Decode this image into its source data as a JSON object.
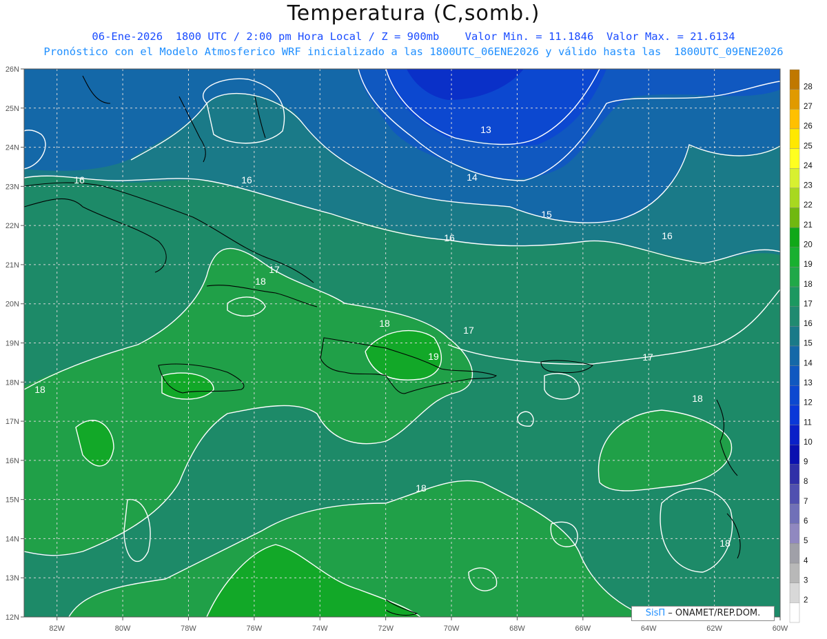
{
  "header": {
    "title": "Temperatura (C,somb.)",
    "line1": "06-Ene-2026  1800 UTC / 2:00 pm Hora Local / Z = 900mb    Valor Min. = 11.1846  Valor Max. = 21.6134",
    "line2": "Pronóstico con el Modelo Atmosferico WRF inicializado a las 1800UTC_06ENE2026 y válido hasta las  1800UTC_09ENE2026"
  },
  "credit": {
    "brand": "SisΠ",
    "text": " – ONAMET/REP.DOM."
  },
  "map_data": {
    "lon_range": [
      -83,
      -60
    ],
    "lat_range": [
      12,
      26
    ],
    "lon_ticks": [
      "82W",
      "80W",
      "78W",
      "76W",
      "74W",
      "72W",
      "70W",
      "68W",
      "66W",
      "64W",
      "62W",
      "60W"
    ],
    "lat_ticks": [
      "12N",
      "13N",
      "14N",
      "15N",
      "16N",
      "17N",
      "18N",
      "19N",
      "20N",
      "21N",
      "22N",
      "23N",
      "24N",
      "25N",
      "26N"
    ],
    "contour_labels": [
      "16",
      "16",
      "13",
      "14",
      "15",
      "16",
      "16",
      "17",
      "18",
      "18",
      "17",
      "19",
      "17",
      "18",
      "18",
      "18",
      "18"
    ],
    "colorbar": {
      "levels": [
        "28",
        "27",
        "26",
        "25",
        "24",
        "23",
        "22",
        "21",
        "20",
        "19",
        "18",
        "17",
        "16",
        "15",
        "14",
        "13",
        "12",
        "11",
        "10",
        "9",
        "8",
        "7",
        "6",
        "5",
        "4",
        "3",
        "2"
      ],
      "colors": [
        "#c07800",
        "#e09a00",
        "#ffc000",
        "#ffe800",
        "#ffff20",
        "#d8f030",
        "#a8d820",
        "#70b810",
        "#10a818",
        "#18b030",
        "#20a848",
        "#1c9860",
        "#208a70",
        "#1a7a88",
        "#1468a8",
        "#1058c0",
        "#0c48d0",
        "#0a38d8",
        "#0a20c8",
        "#0a10b0",
        "#3030a8",
        "#5050b0",
        "#7070b8",
        "#9088c0",
        "#a0a0a8",
        "#b8b8b8",
        "#d8d8d8",
        "#ffffff"
      ]
    }
  }
}
